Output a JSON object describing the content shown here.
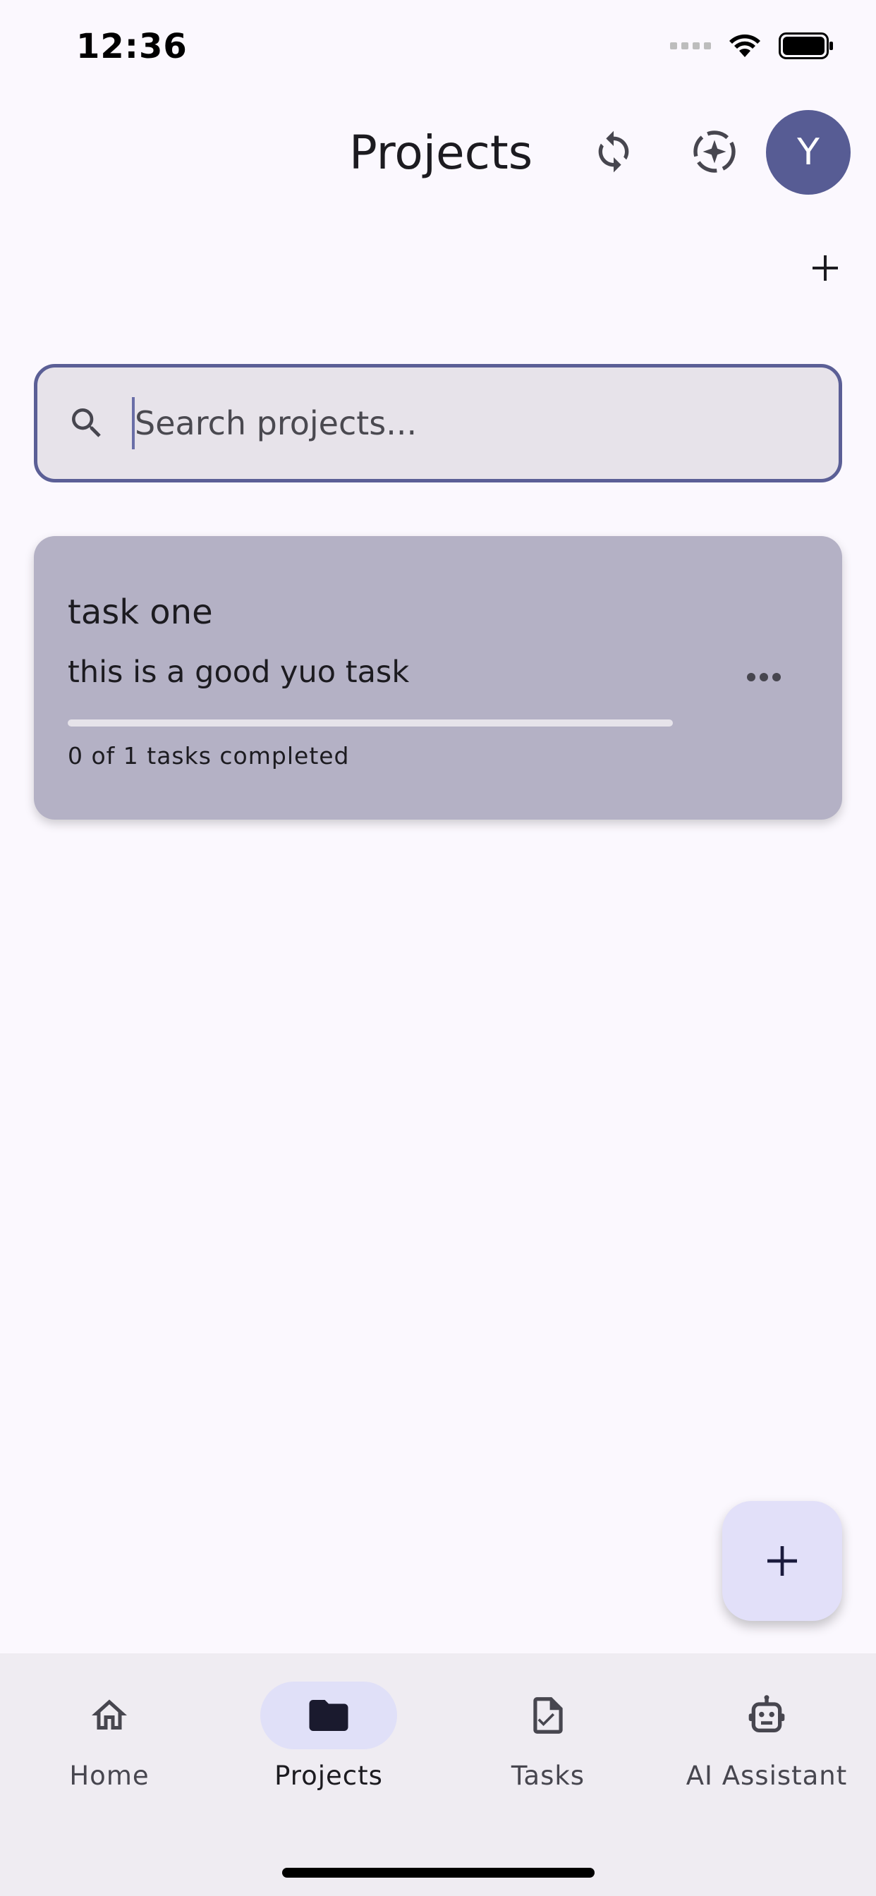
{
  "status_bar": {
    "time": "12:36"
  },
  "app_bar": {
    "title": "Projects",
    "avatar_initial": "Y",
    "icons": [
      "sync-icon",
      "ai-sparkle-icon"
    ]
  },
  "search": {
    "placeholder": "Search projects...",
    "value": ""
  },
  "projects": [
    {
      "title": "task one",
      "description": "this is a good yuo task",
      "progress": 0,
      "progress_text": "0 of 1 tasks completed"
    }
  ],
  "bottom_nav": {
    "items": [
      {
        "label": "Home",
        "icon": "home-icon",
        "active": false
      },
      {
        "label": "Projects",
        "icon": "folder-icon",
        "active": true
      },
      {
        "label": "Tasks",
        "icon": "task-check-icon",
        "active": false
      },
      {
        "label": "AI Assistant",
        "icon": "robot-icon",
        "active": false
      }
    ]
  },
  "colors": {
    "background": "#fbf8fe",
    "primary": "#575c94",
    "card": "#b4b1c5",
    "fab": "#e2e0f9",
    "nav_background": "#efecf2",
    "nav_active": "#e0e0f8"
  }
}
